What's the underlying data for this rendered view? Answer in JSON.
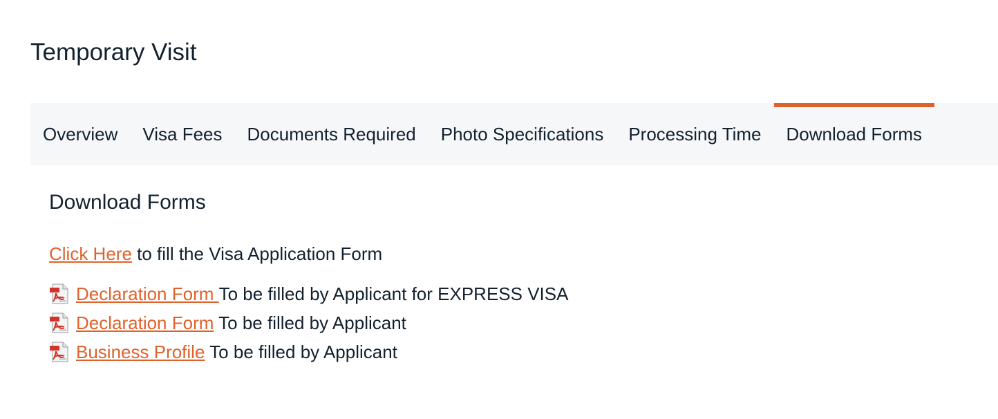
{
  "page": {
    "title": "Temporary Visit"
  },
  "tabs": [
    {
      "label": "Overview",
      "active": false
    },
    {
      "label": "Visa Fees",
      "active": false
    },
    {
      "label": "Documents Required",
      "active": false
    },
    {
      "label": "Photo Specifications",
      "active": false
    },
    {
      "label": "Processing Time",
      "active": false
    },
    {
      "label": "Download Forms",
      "active": true
    }
  ],
  "section": {
    "title": "Download Forms",
    "intro": {
      "link_text": "Click Here",
      "suffix": " to fill the Visa Application Form"
    },
    "forms": [
      {
        "link_text": "Declaration Form ",
        "description": "To be filled by Applicant for EXPRESS VISA",
        "icon": "pdf-icon"
      },
      {
        "link_text": "Declaration Form",
        "description": " To be filled by Applicant",
        "icon": "pdf-icon"
      },
      {
        "link_text": "Business Profile",
        "description": " To be filled by Applicant",
        "icon": "pdf-icon"
      }
    ]
  },
  "colors": {
    "accent": "#e0622b",
    "tab_bar_bg": "#f6f7f8",
    "text": "#13202e",
    "pdf_red": "#d0342c"
  }
}
